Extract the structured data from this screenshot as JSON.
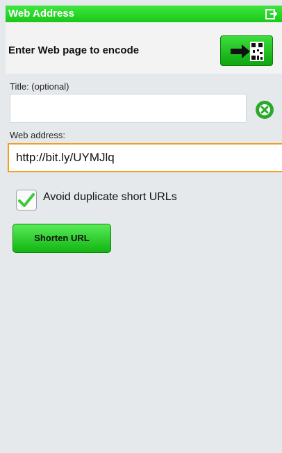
{
  "titlebar": {
    "title": "Web Address",
    "exit_icon": "exit-icon"
  },
  "header": {
    "label": "Enter Web page to encode",
    "encode_icon": "arrow-qr-icon"
  },
  "form": {
    "title_label": "Title: (optional)",
    "title_value": "",
    "clear_icon": "clear-icon",
    "web_label": "Web address:",
    "web_value": "http://bit.ly/UYMJlq",
    "avoid_duplicates_label": "Avoid duplicate short URLs",
    "avoid_duplicates_checked": true,
    "shorten_label": "Shorten URL"
  },
  "colors": {
    "accent_green": "#18c818",
    "focus_border": "#f0a020"
  }
}
